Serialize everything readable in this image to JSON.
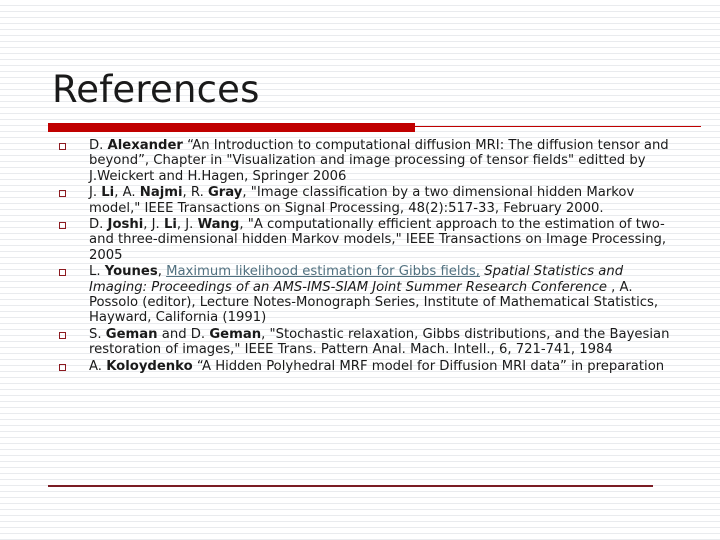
{
  "slide": {
    "title": "References",
    "accent_color": "#c00000",
    "bullet_color": "#8c1a20",
    "link_color": "#50707f",
    "bottom_rule_color": "#7b1d24"
  },
  "references": [
    {
      "id": "ref-alexander",
      "bullet": "square-bullet",
      "plain_text": "D. Alexander “An Introduction to computational diffusion MRI: The diffusion tensor and beyond”, Chapter in \"Visualization and image processing of tensor fields\" editted by J.Weickert and H.Hagen, Springer 2006",
      "parts": [
        {
          "text": "D. ",
          "style": "normal"
        },
        {
          "text": "Alexander",
          "style": "bold"
        },
        {
          "text": " “An Introduction to computational diffusion MRI: The diffusion tensor and beyond”, Chapter in \"Visualization and image processing of tensor fields\" editted by J.Weickert and H.Hagen, Springer 2006",
          "style": "normal"
        }
      ]
    },
    {
      "id": "ref-li-najmi-gray",
      "bullet": "square-bullet",
      "plain_text": "J. Li, A. Najmi, R. Gray, \"Image classification by a two dimensional hidden Markov model,\" IEEE Transactions on Signal Processing, 48(2):517-33, February 2000.",
      "parts": [
        {
          "text": "J. ",
          "style": "normal"
        },
        {
          "text": "Li",
          "style": "bold"
        },
        {
          "text": ", A. ",
          "style": "normal"
        },
        {
          "text": "Najmi",
          "style": "bold"
        },
        {
          "text": ", R. ",
          "style": "normal"
        },
        {
          "text": "Gray",
          "style": "bold"
        },
        {
          "text": ", \"Image classification by a two dimensional hidden Markov model,\" IEEE Transactions on Signal Processing, 48(2):517-33, February 2000.",
          "style": "normal"
        }
      ]
    },
    {
      "id": "ref-joshi-li-wang",
      "bullet": "square-bullet",
      "plain_text": "D. Joshi, J. Li, J. Wang, \"A computationally efficient approach to the estimation of two- and three-dimensional hidden Markov models,\" IEEE Transactions on Image Processing, 2005",
      "parts": [
        {
          "text": "D. ",
          "style": "normal"
        },
        {
          "text": "Joshi",
          "style": "bold"
        },
        {
          "text": ", J. ",
          "style": "normal"
        },
        {
          "text": "Li",
          "style": "bold"
        },
        {
          "text": ", J. ",
          "style": "normal"
        },
        {
          "text": "Wang",
          "style": "bold"
        },
        {
          "text": ", \"A computationally efficient approach to the estimation of two- and three-dimensional hidden Markov models,\" IEEE Transactions on Image Processing, 2005",
          "style": "normal"
        }
      ]
    },
    {
      "id": "ref-younes",
      "bullet": "square-bullet",
      "plain_text": "L. Younes, Maximum likelihood estimation for Gibbs fields, Spatial Statistics and Imaging: Proceedings of an AMS-IMS-SIAM Joint Summer Research Conference , A. Possolo (editor), Lecture Notes-Monograph Series, Institute of Mathematical Statistics, Hayward, California (1991)",
      "parts": [
        {
          "text": "L. ",
          "style": "normal"
        },
        {
          "text": "Younes",
          "style": "bold"
        },
        {
          "text": ", ",
          "style": "normal"
        },
        {
          "text": "Maximum likelihood estimation for Gibbs fields,",
          "style": "link"
        },
        {
          "text": " ",
          "style": "normal"
        },
        {
          "text": "Spatial Statistics and Imaging: Proceedings of an AMS-IMS-SIAM Joint Summer Research Conference ",
          "style": "italic"
        },
        {
          "text": ", A. Possolo (editor), Lecture Notes-Monograph Series, Institute of Mathematical Statistics, Hayward, California (1991)",
          "style": "normal"
        }
      ]
    },
    {
      "id": "ref-geman-geman",
      "bullet": "square-bullet",
      "plain_text": "S. Geman and D. Geman, \"Stochastic relaxation, Gibbs distributions, and the Bayesian restoration of images,\" IEEE Trans. Pattern Anal. Mach. Intell., 6, 721-741, 1984",
      "parts": [
        {
          "text": "S. ",
          "style": "normal"
        },
        {
          "text": "Geman",
          "style": "bold"
        },
        {
          "text": " and D. ",
          "style": "normal"
        },
        {
          "text": "Geman",
          "style": "bold"
        },
        {
          "text": ", \"Stochastic relaxation, Gibbs distributions, and the Bayesian restoration of images,\" IEEE Trans. Pattern Anal. Mach. Intell., 6, 721-741, 1984",
          "style": "normal"
        }
      ]
    },
    {
      "id": "ref-koloydenko",
      "bullet": "square-bullet",
      "plain_text": "A. Koloydenko “A Hidden Polyhedral MRF model for Diffusion MRI data” in preparation",
      "parts": [
        {
          "text": "A. ",
          "style": "normal"
        },
        {
          "text": "Koloydenko",
          "style": "bold"
        },
        {
          "text": " “A Hidden Polyhedral MRF model for Diffusion MRI data” in preparation",
          "style": "normal"
        }
      ]
    }
  ]
}
